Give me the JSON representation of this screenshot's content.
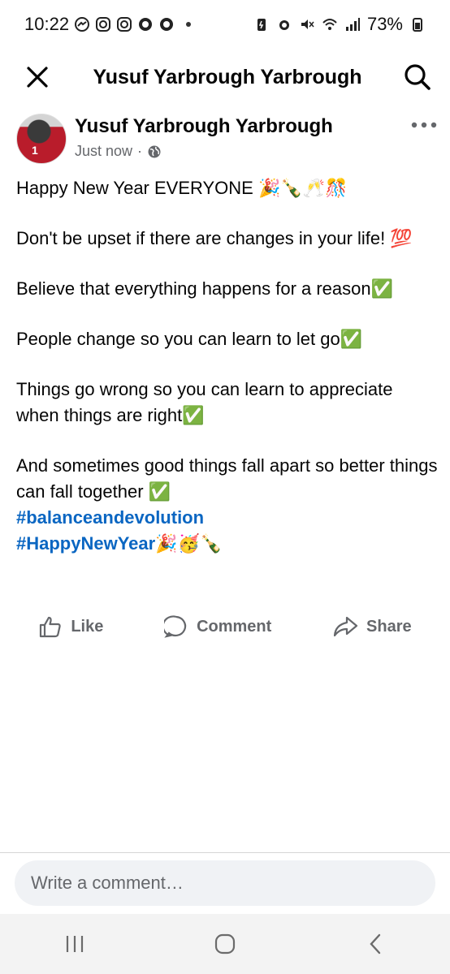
{
  "status_bar": {
    "time": "10:22",
    "battery": "73%",
    "icons_left": [
      "messenger-icon",
      "instagram-icon",
      "instagram-icon",
      "app-icon",
      "app-icon"
    ],
    "icons_right": [
      "battery-saver-icon",
      "alarm-icon",
      "mute-icon",
      "wifi-icon",
      "signal-icon",
      "battery-icon"
    ]
  },
  "header": {
    "title": "Yusuf Yarbrough Yarbrough",
    "close_icon": "close-icon",
    "search_icon": "search-icon"
  },
  "post": {
    "author": "Yusuf Yarbrough Yarbrough",
    "time": "Just now",
    "separator": "·",
    "privacy_icon": "globe-icon",
    "paragraphs": [
      "Happy New Year EVERYONE 🎉🍾🥂🎊",
      "Don't be upset if there are changes in your life! 💯",
      "Believe that everything happens for a reason✅",
      "People change so you can learn to let go✅",
      "Things go wrong so you can learn to appreciate when things are right✅",
      "And sometimes good things fall apart so better things can fall together ✅"
    ],
    "hashtags": [
      "#balanceandevolution",
      "#HappyNewYear"
    ],
    "hashtag_suffix": "🎉🥳🍾"
  },
  "actions": {
    "like": "Like",
    "comment": "Comment",
    "share": "Share"
  },
  "comment_box": {
    "placeholder": "Write a comment…"
  },
  "colors": {
    "hashtag": "#0a66c2",
    "meta": "#65676b",
    "input_bg": "#f0f2f5"
  }
}
